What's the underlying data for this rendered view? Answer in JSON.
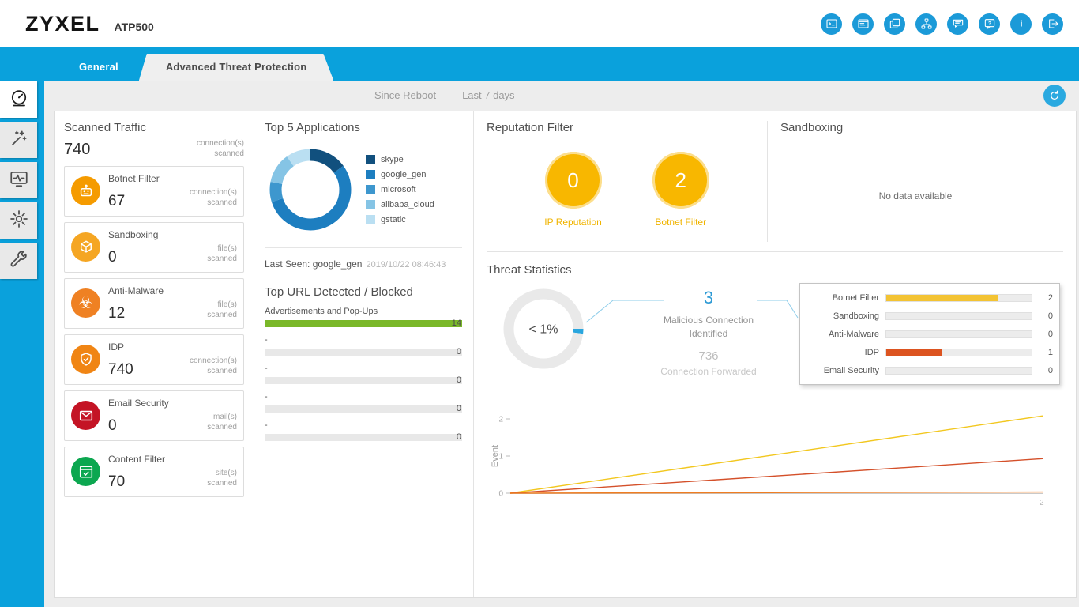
{
  "header": {
    "logo": "ZYXEL",
    "model": "ATP500",
    "icons": [
      {
        "name": "web-console-icon"
      },
      {
        "name": "cli-icon"
      },
      {
        "name": "reference-icon"
      },
      {
        "name": "site-map-icon"
      },
      {
        "name": "forum-icon"
      },
      {
        "name": "help-icon"
      },
      {
        "name": "about-icon"
      },
      {
        "name": "logout-icon"
      }
    ]
  },
  "nav": {
    "tabs": [
      {
        "id": "general",
        "label": "General",
        "active": false
      },
      {
        "id": "advanced-threat-protection",
        "label": "Advanced Threat Protection",
        "active": true
      }
    ]
  },
  "sidebar": {
    "items": [
      {
        "name": "dashboard",
        "active": true
      },
      {
        "name": "quick-setup",
        "active": false
      },
      {
        "name": "monitor",
        "active": false
      },
      {
        "name": "configuration",
        "active": false
      },
      {
        "name": "maintenance",
        "active": false
      }
    ]
  },
  "toolbar": {
    "ranges": [
      "Since Reboot",
      "Last 7 days"
    ]
  },
  "scanned_traffic": {
    "title": "Scanned Traffic",
    "total": "740",
    "total_unit_lines": [
      "connection(s)",
      "scanned"
    ],
    "cards": [
      {
        "name": "Botnet Filter",
        "value": "67",
        "unit_lines": [
          "connection(s)",
          "scanned"
        ],
        "color": "#f59b00",
        "icon": "robot-icon"
      },
      {
        "name": "Sandboxing",
        "value": "0",
        "unit_lines": [
          "file(s)",
          "scanned"
        ],
        "color": "#f5a623",
        "icon": "sandbox-icon"
      },
      {
        "name": "Anti-Malware",
        "value": "12",
        "unit_lines": [
          "file(s)",
          "scanned"
        ],
        "color": "#ef8123",
        "icon": "biohazard-icon"
      },
      {
        "name": "IDP",
        "value": "740",
        "unit_lines": [
          "connection(s)",
          "scanned"
        ],
        "color": "#f08514",
        "icon": "shield-icon"
      },
      {
        "name": "Email Security",
        "value": "0",
        "unit_lines": [
          "mail(s)",
          "scanned"
        ],
        "color": "#c41425",
        "icon": "mail-icon"
      },
      {
        "name": "Content Filter",
        "value": "70",
        "unit_lines": [
          "site(s)",
          "scanned"
        ],
        "color": "#0ca750",
        "icon": "browser-icon"
      }
    ]
  },
  "top_applications": {
    "title": "Top 5 Applications",
    "last_seen_label": "Last Seen: google_gen",
    "last_seen_time": "2019/10/22 08:46:43"
  },
  "top_url": {
    "title": "Top URL Detected / Blocked",
    "max": 14,
    "rows": [
      {
        "label": "Advertisements and Pop-Ups",
        "value": 14,
        "color": "#7ab829"
      },
      {
        "label": "-",
        "value": 0,
        "color": "#7ab829"
      },
      {
        "label": "-",
        "value": 0,
        "color": "#7ab829"
      },
      {
        "label": "-",
        "value": 0,
        "color": "#7ab829"
      },
      {
        "label": "-",
        "value": 0,
        "color": "#7ab829"
      }
    ]
  },
  "reputation_filter": {
    "title": "Reputation Filter",
    "circle_color": "#f8b700",
    "items": [
      {
        "label": "IP Reputation",
        "value": "0"
      },
      {
        "label": "Botnet Filter",
        "value": "2"
      }
    ]
  },
  "sandboxing_panel": {
    "title": "Sandboxing",
    "empty_text": "No data available"
  },
  "threat_statistics": {
    "title": "Threat Statistics",
    "malicious_value": "3",
    "malicious_label_lines": [
      "Malicious Connection",
      "Identified"
    ],
    "forwarded_value": "736",
    "forwarded_label": "Connection Forwarded"
  },
  "chart_data": [
    {
      "id": "top_apps",
      "type": "pie",
      "title": "Top 5 Applications",
      "legend_position": "right",
      "series": [
        {
          "name": "skype",
          "value": 15,
          "color": "#11507e"
        },
        {
          "name": "google_gen",
          "value": 55,
          "color": "#1d7ec0"
        },
        {
          "name": "microsoft",
          "value": 8,
          "color": "#3d97ce"
        },
        {
          "name": "alibaba_cloud",
          "value": 12,
          "color": "#85c4e5"
        },
        {
          "name": "gstatic",
          "value": 10,
          "color": "#badff2"
        }
      ]
    },
    {
      "id": "threat_ratio",
      "type": "pie",
      "center_label": "< 1%",
      "series": [
        {
          "name": "malicious",
          "value": 2,
          "color": "#2aa6de"
        },
        {
          "name": "forwarded",
          "value": 98,
          "color": "#e9e9e9"
        }
      ]
    },
    {
      "id": "threat_bars",
      "type": "bar",
      "orientation": "horizontal",
      "max": 2.6,
      "categories": [
        "Botnet Filter",
        "Sandboxing",
        "Anti-Malware",
        "IDP",
        "Email Security"
      ],
      "values": [
        2,
        0,
        0,
        1,
        0
      ],
      "colors": [
        "#f3c333",
        "#f3c333",
        "#f3c333",
        "#dc5420",
        "#f3c333"
      ]
    },
    {
      "id": "event_trend",
      "type": "line",
      "ylabel": "Event",
      "yticks": [
        0,
        1,
        2
      ],
      "ylim": [
        0,
        2.2
      ],
      "x_end_label": "2",
      "series": [
        {
          "name": "series-yellow",
          "color": "#f2c71f",
          "end_value": 2.08
        },
        {
          "name": "series-red",
          "color": "#d4502a",
          "end_value": 0.93
        },
        {
          "name": "series-orange",
          "color": "#ef7d21",
          "end_value": 0.03
        }
      ]
    }
  ]
}
